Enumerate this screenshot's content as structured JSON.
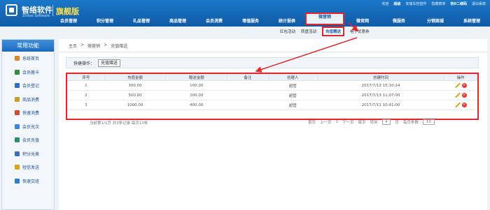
{
  "brand": {
    "name": "智络软件",
    "subtitle": "Zhiluo Software",
    "edition": "旗舰版"
  },
  "toplinks": [
    "欢迎",
    "超级",
    "安装车控插件",
    "隐藏菜单",
    "快0二维码",
    "退出系统"
  ],
  "mainnav": [
    "会员管理",
    "积分管理",
    "礼品管理",
    "商品管理",
    "会员消费",
    "增值服务",
    "统计报表",
    "微营销",
    "微官网",
    "微服务",
    "分销商城",
    "系统管理"
  ],
  "mainnav_active": "微营销",
  "subnav": [
    "红包活动",
    "转盘活动",
    "充值赠送",
    "电子优惠券"
  ],
  "subnav_active": "充值赠送",
  "sidebar": {
    "title": "常用功能",
    "items": [
      {
        "label": "系统首页",
        "color": "#d6872b"
      },
      {
        "label": "会员搬卡",
        "color": "#2f8f3f"
      },
      {
        "label": "会员登记",
        "color": "#2b6fc6"
      },
      {
        "label": "商品消费",
        "color": "#c4a02a"
      },
      {
        "label": "快速消费",
        "color": "#d04a3b"
      },
      {
        "label": "会员充次",
        "color": "#3b86d6"
      },
      {
        "label": "会员充值",
        "color": "#2b8f6a"
      },
      {
        "label": "积分兑换",
        "color": "#3a6fc0"
      },
      {
        "label": "短信发送",
        "color": "#d9a21f"
      },
      {
        "label": "快速交班",
        "color": "#2f7bd0"
      }
    ]
  },
  "breadcrumb": [
    "主页",
    ">",
    "微营销",
    ">",
    "充值赠送"
  ],
  "quickbar": {
    "label": "快捷操作：",
    "button": "充值赠送"
  },
  "table": {
    "headers": [
      "序号",
      "充值金额",
      "赠送金额",
      "备注",
      "创建人",
      "创建时间",
      "操作"
    ],
    "rows": [
      [
        "1",
        "300.00",
        "100.00",
        "",
        "超管",
        "2017/7/13 15:10:24"
      ],
      [
        "2",
        "500.00",
        "200.00",
        "",
        "超管",
        "2017/7/13 11:07:00"
      ],
      [
        "3",
        "1000.00",
        "400.00",
        "",
        "超管",
        "2017/7/11 10:41:00"
      ]
    ]
  },
  "pager": {
    "summary": "当前第1/1页 共3条记录 每页10条",
    "first": "首页",
    "prev": "上一页",
    "page": "1",
    "next": "下一页",
    "last": "尾页",
    "goto": "转到",
    "unit": "页",
    "per_page_label": "每页条数",
    "per_page": "10"
  },
  "colors": {
    "header": "#1563b3",
    "highlight": "#e5252a",
    "edit": "#e1a21a",
    "delete": "#e33333"
  }
}
